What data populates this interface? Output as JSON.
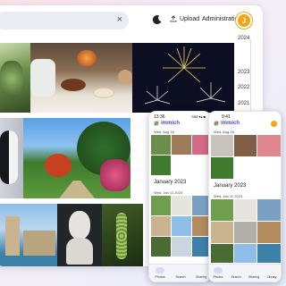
{
  "topbar": {
    "search_clear": "×",
    "upload_label": "Upload",
    "admin_label": "Administration",
    "avatar_initial": "J"
  },
  "scrubber": {
    "years": [
      "2024",
      "2023",
      "2022",
      "2021",
      "2020"
    ]
  },
  "phone_left": {
    "status_time": "13:36",
    "status_icons": "SIM ▾▴ ■",
    "brand": "immich",
    "date_header": "Wed, Aug 16",
    "month_header": "January 2023",
    "date_header_2": "Wed, Jan 11 2023",
    "nav": [
      "Photos",
      "Search",
      "Sharing"
    ]
  },
  "phone_right": {
    "status_time": "9:41",
    "brand": "immich",
    "date_header": "Wed, Aug 16",
    "month_header": "January 2023",
    "date_header_2": "Wed, Jan 11 2023",
    "nav": [
      "Photos",
      "Search",
      "Sharing",
      "Library"
    ]
  },
  "colors": {
    "accent": "#4250af",
    "avatar": "#f2a516"
  },
  "icons": [
    "moon-icon",
    "upload-icon",
    "immich-logo-icon",
    "photos-icon",
    "search-icon",
    "sharing-icon",
    "library-icon"
  ]
}
